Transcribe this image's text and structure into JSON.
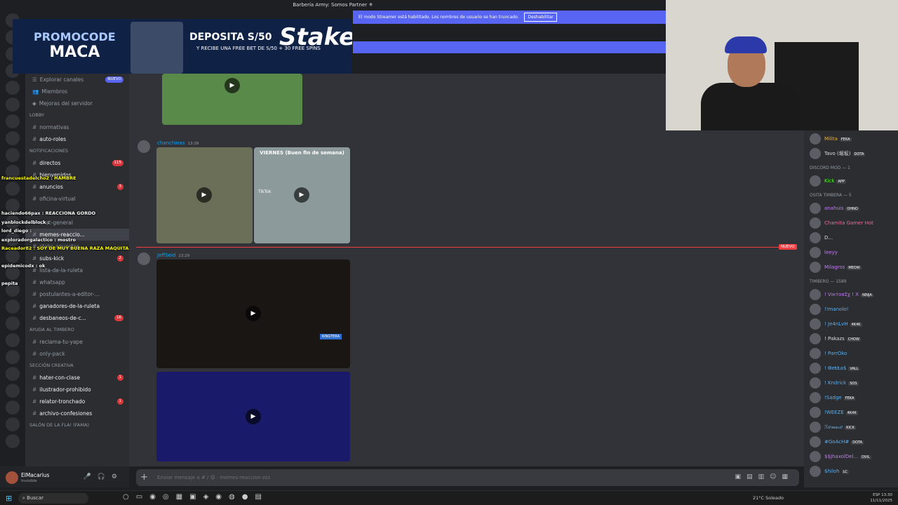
{
  "title": "Barbería Army: Somos Partner ⚜",
  "streamer_bar": {
    "text": "El modo Streamer está habilitado. Los nombres de usuario se han truncado.",
    "button": "Deshabilitar"
  },
  "promo": {
    "code_label": "PROMOCODE",
    "code": "MACA",
    "deposit": "DEPOSITA S/50",
    "offer": "Y RECIBE UNA FREE BET DE S/50 + 30 FREE SPINS",
    "brand": "Stake"
  },
  "sidebar": {
    "top_items": [
      {
        "label": "Explorar canales",
        "badge": "NUEVO"
      },
      {
        "label": "Miembros"
      },
      {
        "label": "Mejoras del servidor"
      }
    ],
    "channels": [
      {
        "type": "cat",
        "label": "LOBBY"
      },
      {
        "type": "ch",
        "label": "normativas"
      },
      {
        "type": "ch",
        "label": "auto-roles",
        "bold": true
      },
      {
        "type": "cat",
        "label": "NOTIFICACIONES"
      },
      {
        "type": "ch",
        "label": "directos",
        "bold": true,
        "badge": "115"
      },
      {
        "type": "ch",
        "label": "bienvenidos",
        "bold": true
      },
      {
        "type": "ch",
        "label": "anuncios",
        "bold": true,
        "badge": "3"
      },
      {
        "type": "ch",
        "label": "oficina-virtual"
      },
      {
        "type": "cat",
        "label": ""
      },
      {
        "type": "ch",
        "label": "chat-general"
      },
      {
        "type": "ch",
        "label": "memes-reaccio...",
        "selected": true
      },
      {
        "type": "ch",
        "label": "stake-apuestas"
      },
      {
        "type": "ch",
        "label": "subs-kick",
        "bold": true,
        "badge": "2"
      },
      {
        "type": "ch",
        "label": "lista-de-la-ruleta"
      },
      {
        "type": "ch",
        "label": "whatsapp"
      },
      {
        "type": "ch",
        "label": "postulantes-a-editor-..."
      },
      {
        "type": "ch",
        "label": "ganadores-de-la-ruleta",
        "bold": true
      },
      {
        "type": "ch",
        "label": "desbaneos-de-c...",
        "bold": true,
        "badge": "16"
      },
      {
        "type": "cat",
        "label": "AYUDA AL TIMBERO"
      },
      {
        "type": "ch",
        "label": "reclama-tu-yape"
      },
      {
        "type": "ch",
        "label": "only-pack"
      },
      {
        "type": "cat",
        "label": "SECCIÓN CREATIVA"
      },
      {
        "type": "ch",
        "label": "hater-con-clase",
        "bold": true,
        "badge": "1"
      },
      {
        "type": "ch",
        "label": "ilustrador-prohibido",
        "bold": true
      },
      {
        "type": "ch",
        "label": "relator-tronchado",
        "bold": true,
        "badge": "1"
      },
      {
        "type": "ch",
        "label": "archivo-confesiones",
        "bold": true
      },
      {
        "type": "cat",
        "label": "SALÓN DE LA FLA! (FAMA)"
      }
    ]
  },
  "chat_overlay": [
    "francuestadelcho2 : HAMBRE",
    "haciendo66pax : REACCIONA GORDO",
    "yanblockdelblock :",
    "lord_diego :",
    "exploradorgalactico : mostro",
    "Raceador82 : SOY DE MUY BUENA RAZA MAQUITA",
    "epidemicodx : ok",
    "pepita"
  ],
  "messages": [
    {
      "author": "chanchinxs",
      "time": "13:28"
    },
    {
      "author": "JeffSeid",
      "time": "13:29"
    }
  ],
  "video_caption": "VIERNES (Buen fin de semana)",
  "video_tag": "KINGTERA",
  "tiktok_label": "TikTok",
  "new_label": "NUEVO",
  "input": {
    "placeholder": "Enviar mensaje a # / 😋 · memes-reaccion-zzz"
  },
  "user": {
    "name": "ElMacarius",
    "status": "Invisible"
  },
  "members": [
    {
      "type": "m",
      "name": "Milita",
      "tag": "FEKA",
      "color": "#f0b232"
    },
    {
      "type": "m",
      "name": "Tavo (堀坂)",
      "tag": "DOTA",
      "color": "#dbdee1"
    },
    {
      "type": "c",
      "name": "DISCORD MOD — 1"
    },
    {
      "type": "m",
      "name": "Kick",
      "tag": "APP",
      "color": "#53fc18"
    },
    {
      "type": "c",
      "name": "OSITA TIMBERA — 5"
    },
    {
      "type": "m",
      "name": "anahuis",
      "tag": "OHNO",
      "color": "#c27cf0"
    },
    {
      "type": "m",
      "name": "Chamita Gamer Hot",
      "tag": "",
      "color": "#e86f9b"
    },
    {
      "type": "m",
      "name": "D...",
      "tag": "",
      "color": "#dbdee1"
    },
    {
      "type": "m",
      "name": "leeyy",
      "tag": "",
      "color": "#c27cf0"
    },
    {
      "type": "m",
      "name": "Milagros",
      "tag": "MEOW",
      "color": "#c27cf0"
    },
    {
      "type": "c",
      "name": "TIMBERO — 1589"
    },
    {
      "type": "m",
      "name": "! VıктoяΣχ ! X",
      "tag": "NINJA",
      "color": "#c27cf0"
    },
    {
      "type": "m",
      "name": "!!manolo!",
      "tag": "",
      "color": "#5dadec"
    },
    {
      "type": "m",
      "name": "! Je4nLvH",
      "tag": "4K4K",
      "color": "#5dadec"
    },
    {
      "type": "m",
      "name": "! Pakazs",
      "tag": "CHOW",
      "color": "#dbdee1"
    },
    {
      "type": "m",
      "name": "! ParrOko",
      "tag": "",
      "color": "#5dadec"
    },
    {
      "type": "m",
      "name": "! ϴeⱠⱠa$",
      "tag": "VALL",
      "color": "#5dadec"
    },
    {
      "type": "m",
      "name": "! Kndrick",
      "tag": "SOS",
      "color": "#5dadec"
    },
    {
      "type": "m",
      "name": "!Sadge",
      "tag": "FEKA",
      "color": "#5dadec"
    },
    {
      "type": "m",
      "name": "!WEEZE",
      "tag": "4K4K",
      "color": "#5dadec"
    },
    {
      "type": "m",
      "name": "ℛℯ𝓂𝒶𝓈ℯ",
      "tag": "KICK",
      "color": "#5dadec"
    },
    {
      "type": "m",
      "name": "#GoAcH#",
      "tag": "DOTA",
      "color": "#5dadec"
    },
    {
      "type": "m",
      "name": "$$JhaxolDel...",
      "tag": "DVIL",
      "color": "#c27cf0"
    },
    {
      "type": "m",
      "name": "$hiloh",
      "tag": "LC",
      "color": "#5dadec"
    }
  ],
  "taskbar": {
    "search": "Buscar",
    "weather": "21°C  Soleado",
    "lang": "ESP",
    "time": "13:30",
    "date": "11/11/2025"
  }
}
